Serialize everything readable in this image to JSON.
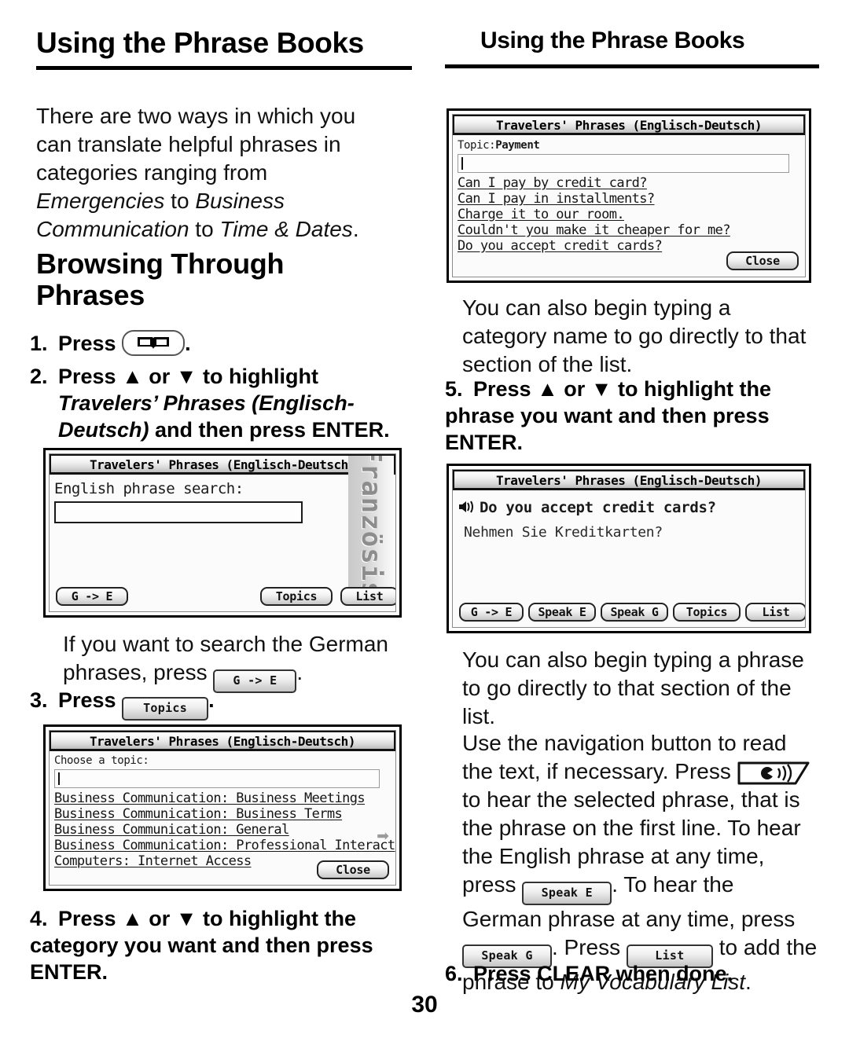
{
  "page": {
    "number": "30",
    "running_head_left": "Using the Phrase Books",
    "running_head_right": "Using the Phrase Books"
  },
  "left_column": {
    "intro_plain_1": "There are two ways in which you can translate helpful phrases in categories ranging from ",
    "intro_italic_1": "Emergencies",
    "intro_plain_2": " to ",
    "intro_italic_2": "Business Communication",
    "intro_plain_3": " to ",
    "intro_italic_3": "Time & Dates",
    "intro_plain_4": ".",
    "section_heading": "Browsing Through Phrases",
    "step1": {
      "num": "1.",
      "text_before": "Press ",
      "key_icon": "book-icon",
      "text_after": "."
    },
    "step2": {
      "num": "2.",
      "line1": "Press ▲ or ▼ to highlight",
      "italic_part": "Travelers’ Phrases (Englisch-Deutsch)",
      "tail": " and then press ENTER."
    },
    "note_german": {
      "before": "If you want to search the German phrases, press ",
      "button": "G -> E",
      "after": "."
    },
    "step3": {
      "num": "3.",
      "text_before": "Press ",
      "button": "Topics",
      "text_after": "."
    },
    "step4": {
      "num": "4.",
      "text": "Press ▲ or ▼ to highlight the category you want and then press ENTER."
    }
  },
  "right_column": {
    "note_category_typing": "You can also begin typing a category name to go directly to that section of the list.",
    "step5": {
      "num": "5.",
      "text": "Press ▲ or ▼ to highlight the phrase you want and then press ENTER."
    },
    "note_phrase_typing": "You can also begin typing a phrase to go directly to that section of the list.",
    "nav_note": {
      "part1": "Use the navigation button to read the text, if necessary. Press ",
      "speaker_key": "speaker-key",
      "part2": " to hear the selected phrase, that is the phrase on the first line. To hear the English phrase at any time, press ",
      "speak_e": "Speak E",
      "part3": ". To hear the German phrase at any time, press ",
      "speak_g": "Speak G",
      "part4": ". Press ",
      "list_btn": "List",
      "part5": " to add the phrase to ",
      "italic": "My Vocabulary List",
      "part6": "."
    },
    "step6": {
      "num": "6.",
      "text": "Press CLEAR when done."
    }
  },
  "screenshots": {
    "payment_list": {
      "title": "Travelers' Phrases (Englisch-Deutsch)",
      "topic_label": "Topic:",
      "topic_value": "Payment",
      "input_value": "",
      "items": [
        "Can I pay by credit card?",
        "Can I pay in installments?",
        "Charge it to our room.",
        "Couldn't you make it cheaper for me?",
        "Do you accept credit cards?"
      ],
      "close_button": "Close"
    },
    "english_search": {
      "title": "Travelers' Phrases (Englisch-Deutsch)",
      "prompt": "English phrase search:",
      "input_value": "",
      "side_label": "Französis",
      "buttons": [
        "G -> E",
        "Topics",
        "List"
      ]
    },
    "choose_topic": {
      "title": "Travelers' Phrases (Englisch-Deutsch)",
      "prompt": "Choose a topic:",
      "input_value": "",
      "items": [
        "Business Communication: Business Meetings",
        "Business Communication: Business Terms",
        "Business Communication: General",
        "Business Communication: Professional Interact",
        "Computers: Internet Access"
      ],
      "more_indicator": "➡",
      "close_button": "Close"
    },
    "phrase_result": {
      "title": "Travelers' Phrases (Englisch-Deutsch)",
      "speaker_icon": "sound-icon",
      "english_phrase": "Do you accept credit cards?",
      "german_phrase": "Nehmen Sie Kreditkarten?",
      "buttons": [
        "G -> E",
        "Speak E",
        "Speak G",
        "Topics",
        "List"
      ]
    }
  }
}
